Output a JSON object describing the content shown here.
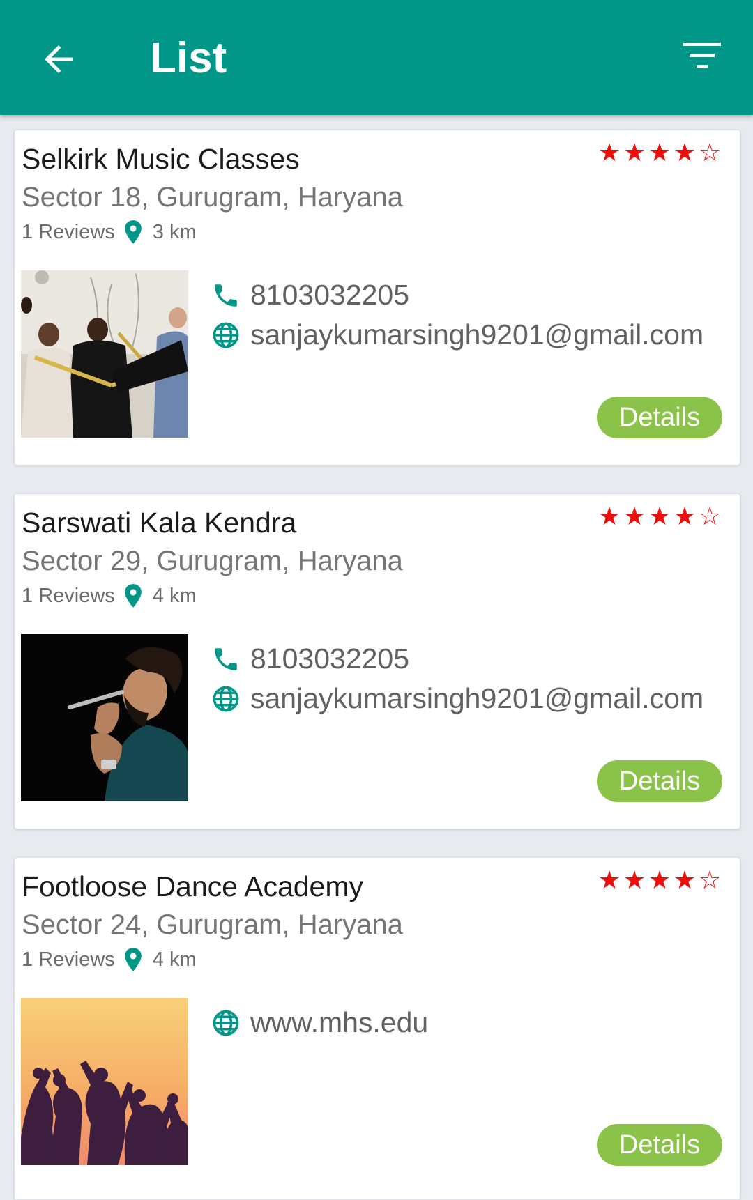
{
  "appbar": {
    "title": "List"
  },
  "colors": {
    "primary": "#009688",
    "star": "#f20d0d",
    "button": "#8bc34a"
  },
  "listings": [
    {
      "name": "Selkirk Music Classes",
      "address": "Sector 18, Gurugram, Haryana",
      "reviews": "1 Reviews",
      "distance": "3 km",
      "rating": 4,
      "stars": [
        "★",
        "★",
        "★",
        "★",
        "☆"
      ],
      "phone": "8103032205",
      "web": "sanjaykumarsingh9201@gmail.com",
      "details_label": "Details",
      "image": "brass-band-photo"
    },
    {
      "name": "Sarswati Kala Kendra",
      "address": "Sector 29, Gurugram, Haryana",
      "reviews": "1 Reviews",
      "distance": "4 km",
      "rating": 4,
      "stars": [
        "★",
        "★",
        "★",
        "★",
        "☆"
      ],
      "phone": "8103032205",
      "web": "sanjaykumarsingh9201@gmail.com",
      "details_label": "Details",
      "image": "singer-photo"
    },
    {
      "name": "Footloose Dance Academy",
      "address": "Sector 24, Gurugram, Haryana",
      "reviews": "1 Reviews",
      "distance": "4 km",
      "rating": 4,
      "stars": [
        "★",
        "★",
        "★",
        "★",
        "☆"
      ],
      "web": "www.mhs.edu",
      "details_label": "Details",
      "image": "dancers-silhouette-photo"
    }
  ]
}
